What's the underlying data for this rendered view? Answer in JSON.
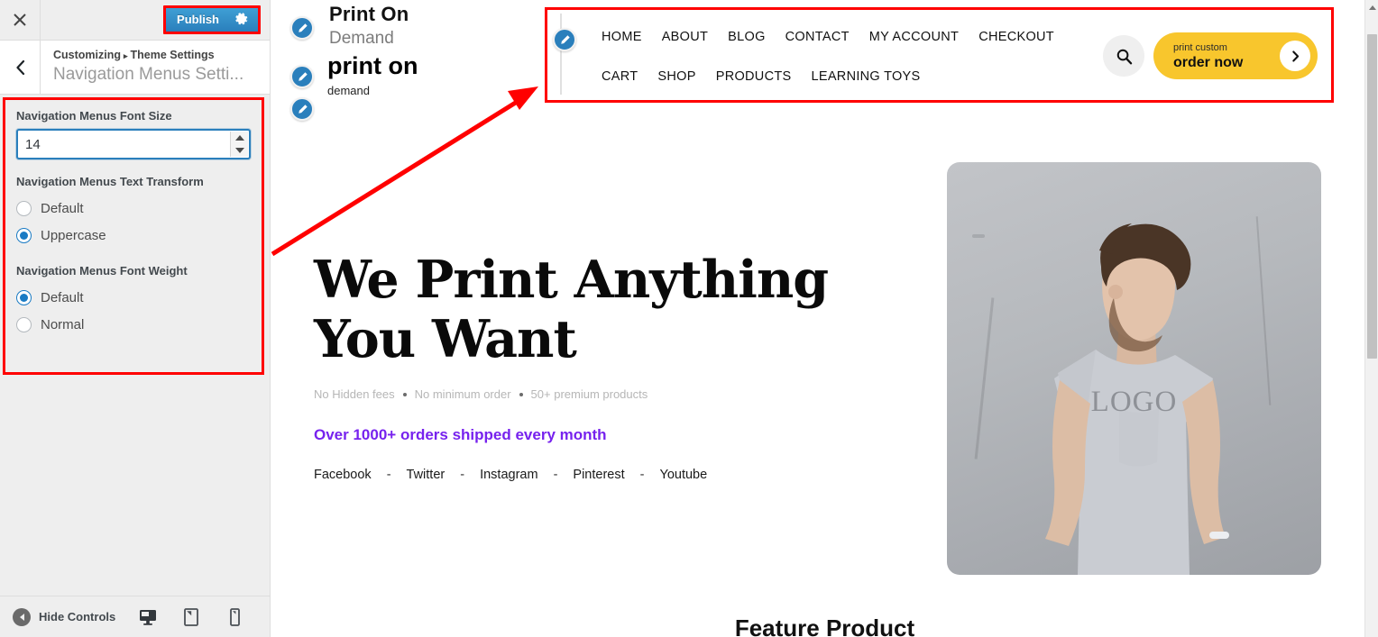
{
  "customizer": {
    "close_icon": "close-icon",
    "publish_label": "Publish",
    "gear_icon": "gear-icon",
    "back_icon": "chevron-left-icon",
    "breadcrumb_root": "Customizing",
    "breadcrumb_sep": "▸",
    "breadcrumb_parent": "Theme Settings",
    "panel_title": "Navigation Menus Setti...",
    "controls": {
      "font_size": {
        "label": "Navigation Menus Font Size",
        "value": "14",
        "placeholder": ""
      },
      "text_transform": {
        "label": "Navigation Menus Text Transform",
        "options": [
          {
            "label": "Default",
            "selected": false
          },
          {
            "label": "Uppercase",
            "selected": true
          }
        ]
      },
      "font_weight": {
        "label": "Navigation Menus Font Weight",
        "options": [
          {
            "label": "Default",
            "selected": true
          },
          {
            "label": "Normal",
            "selected": false
          }
        ]
      }
    },
    "footer": {
      "hide_controls_label": "Hide Controls",
      "devices": [
        {
          "name": "desktop",
          "active": true
        },
        {
          "name": "tablet",
          "active": false
        },
        {
          "name": "mobile",
          "active": false
        }
      ]
    },
    "accent_blue": "#2a7fbc",
    "annotation_red": "#ff0000"
  },
  "preview": {
    "logo": {
      "line1": "Print On",
      "line2": "Demand",
      "line3": "print on",
      "line4": "demand"
    },
    "nav": {
      "row1": [
        "HOME",
        "ABOUT",
        "BLOG",
        "CONTACT",
        "MY ACCOUNT",
        "CHECKOUT"
      ],
      "row2": [
        "CART",
        "SHOP",
        "PRODUCTS",
        "LEARNING TOYS"
      ],
      "search_icon": "search-icon"
    },
    "cta": {
      "eyebrow": "print custom",
      "label": "order now",
      "arrow_icon": "chevron-right-icon",
      "color": "#f8c62d"
    },
    "hero": {
      "heading": "We Print Anything\nYou Want",
      "features": [
        "No Hidden fees",
        "No minimum order",
        "50+ premium products"
      ],
      "highlight": "Over 1000+ orders shipped every month",
      "highlight_color": "#7722ee",
      "social": [
        "Facebook",
        "Twitter",
        "Instagram",
        "Pinterest",
        "Youtube"
      ],
      "social_sep": "-",
      "image_shirt_text": "LOGO"
    },
    "feature_section_title": "Feature Product"
  }
}
